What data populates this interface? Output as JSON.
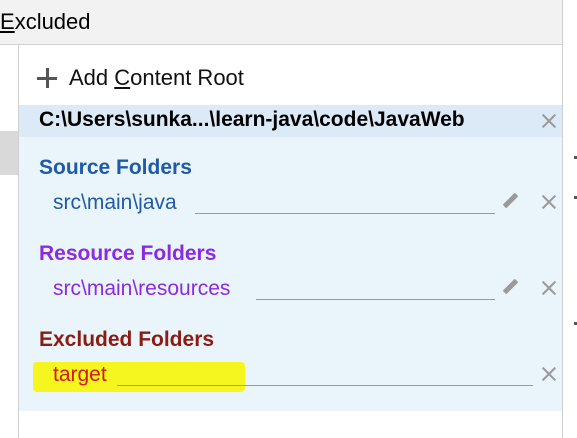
{
  "header": {
    "title_prefix": "E",
    "title_rest": "xcluded"
  },
  "add_content_root": {
    "label_before": "Add ",
    "label_mnemonic": "C",
    "label_after": "ontent Root"
  },
  "root": {
    "path": "C:\\Users\\sunka...\\learn-java\\code\\JavaWeb"
  },
  "sections": {
    "source": {
      "title": "Source Folders",
      "folder": "src\\main\\java",
      "color": "#1f5aa8"
    },
    "resource": {
      "title": "Resource Folders",
      "folder": "src\\main\\resources",
      "color": "#8a2be2"
    },
    "excluded": {
      "title": "Excluded Folders",
      "folder": "target",
      "title_color": "#8b1c14",
      "folder_color": "#d31a1a",
      "highlight": "#f5f51f"
    }
  },
  "icons": {
    "add": "plus-icon",
    "remove": "close-icon",
    "edit": "pencil-icon"
  }
}
